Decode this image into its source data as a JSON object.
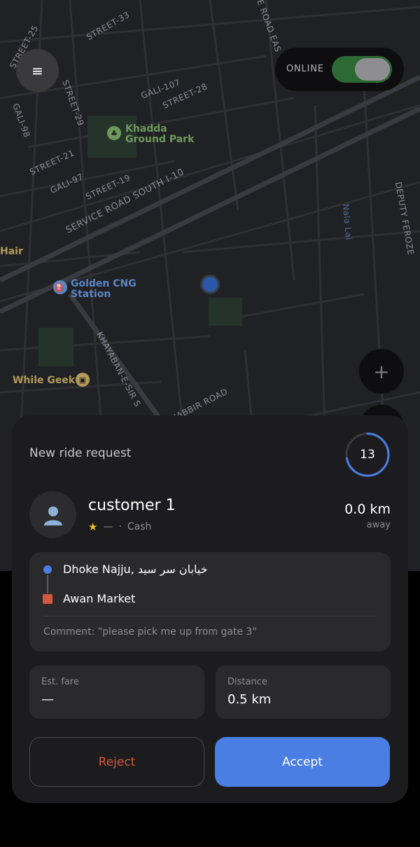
{
  "map": {
    "status_label": "ONLINE",
    "labels": {
      "street_33": "STREET-33",
      "street_25": "STREET-25",
      "street_29": "STREET-29",
      "street_28": "STREET-28",
      "gali_107": "GALI-107",
      "gali_98": "GALI-98",
      "street_21": "STREET-21",
      "gali_97": "GALI-97",
      "street_19": "STREET-19",
      "service_road": "SERVICE ROAD SOUTH I-10",
      "khayaban": "KHAYABAN-E-SIR S",
      "jabbir_road": "JABBIR ROAD",
      "road_east": "E ROAD EAS",
      "nullah_lai": "Nala Lai",
      "deputy_road": "DEPUTY FEROZE"
    },
    "poi": {
      "park": "Khadda Ground Park",
      "cng": "Golden CNG Station",
      "geek": "While Geek",
      "hair": "Hair"
    },
    "zoom_in": "+"
  },
  "request": {
    "title": "New ride request",
    "countdown": "13",
    "countdown_fraction": 0.72,
    "customer": {
      "name": "customer 1",
      "rating": "—",
      "payment": "Cash"
    },
    "distance_away": "0.0 km",
    "away_label": "away",
    "pickup": "Dhoke Najju, خیابان سر سید",
    "dropoff": "Awan Market",
    "comment": "Comment: \"please pick me up from gate 3\"",
    "fare_label": "Est. fare",
    "fare_value": "—",
    "distance_label": "Distance",
    "distance_value": "0.5 km",
    "reject_label": "Reject",
    "accept_label": "Accept"
  },
  "colors": {
    "accent": "#4a7ee3",
    "reject": "#d4573f",
    "online": "#2d6a33"
  }
}
